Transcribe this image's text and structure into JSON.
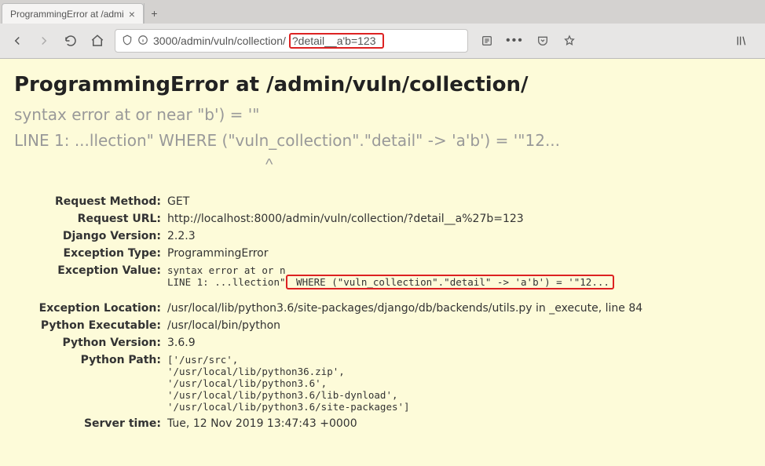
{
  "browser": {
    "tab_title": "ProgrammingError at /admi",
    "url_visible_left": "3000/admin/vuln/collection/",
    "url_visible_boxed": "?detail__a'b=123"
  },
  "error": {
    "heading": "ProgrammingError at /admin/vuln/collection/",
    "sub_line1": "syntax error at or near \"b') = '\"",
    "sub_line2": "LINE 1: ...llection\" WHERE (\"vuln_collection\".\"detail\" -> 'a'b') = '\"12...",
    "caret": "^"
  },
  "meta": {
    "request_method": {
      "label": "Request Method:",
      "value": "GET"
    },
    "request_url": {
      "label": "Request URL:",
      "value": "http://localhost:8000/admin/vuln/collection/?detail__a%27b=123"
    },
    "django_version": {
      "label": "Django Version:",
      "value": "2.2.3"
    },
    "exception_type": {
      "label": "Exception Type:",
      "value": "ProgrammingError"
    },
    "exception_value": {
      "label": "Exception Value:",
      "line1_plain": "syntax error at or n",
      "line2_pre": "LINE 1: ...llection\"",
      "line2_box": " WHERE (\"vuln_collection\".\"detail\" -> 'a'b') = '\"12..."
    },
    "exception_location": {
      "label": "Exception Location:",
      "value": "/usr/local/lib/python3.6/site-packages/django/db/backends/utils.py in _execute, line 84"
    },
    "python_executable": {
      "label": "Python Executable:",
      "value": "/usr/local/bin/python"
    },
    "python_version": {
      "label": "Python Version:",
      "value": "3.6.9"
    },
    "python_path": {
      "label": "Python Path:",
      "lines": [
        "['/usr/src',",
        " '/usr/local/lib/python36.zip',",
        " '/usr/local/lib/python3.6',",
        " '/usr/local/lib/python3.6/lib-dynload',",
        " '/usr/local/lib/python3.6/site-packages']"
      ]
    },
    "server_time": {
      "label": "Server time:",
      "value": "Tue, 12 Nov 2019 13:47:43 +0000"
    }
  }
}
